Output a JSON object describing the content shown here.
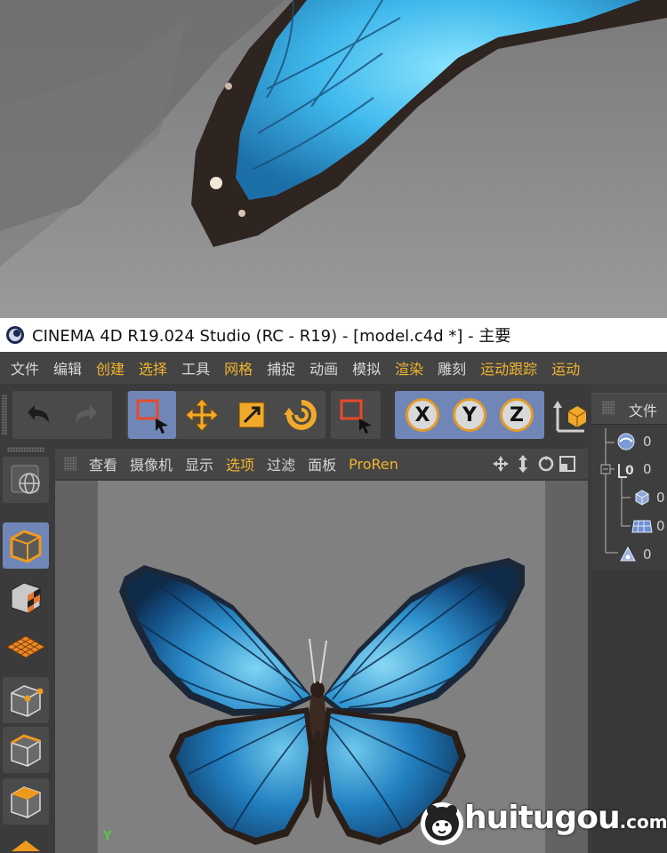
{
  "window": {
    "title": "CINEMA 4D R19.024 Studio (RC - R19) - [model.c4d *] - 主要"
  },
  "menu": {
    "items": [
      {
        "label": "文件",
        "highlight": false
      },
      {
        "label": "编辑",
        "highlight": false
      },
      {
        "label": "创建",
        "highlight": true
      },
      {
        "label": "选择",
        "highlight": true
      },
      {
        "label": "工具",
        "highlight": false
      },
      {
        "label": "网格",
        "highlight": true
      },
      {
        "label": "捕捉",
        "highlight": false
      },
      {
        "label": "动画",
        "highlight": false
      },
      {
        "label": "模拟",
        "highlight": false
      },
      {
        "label": "渲染",
        "highlight": true
      },
      {
        "label": "雕刻",
        "highlight": false
      },
      {
        "label": "运动跟踪",
        "highlight": true
      },
      {
        "label": "运动",
        "highlight": true
      }
    ]
  },
  "toolbar": {
    "axis_x": "X",
    "axis_y": "Y",
    "axis_z": "Z"
  },
  "viewport": {
    "menu": [
      {
        "label": "查看",
        "highlight": false
      },
      {
        "label": "摄像机",
        "highlight": false
      },
      {
        "label": "显示",
        "highlight": false
      },
      {
        "label": "选项",
        "highlight": true
      },
      {
        "label": "过滤",
        "highlight": false
      },
      {
        "label": "面板",
        "highlight": false
      },
      {
        "label": "ProRen",
        "highlight": true
      }
    ],
    "axis_label": "Y"
  },
  "object_panel": {
    "title": "文件",
    "rows": [
      {
        "value": "0"
      },
      {
        "value": "0"
      },
      {
        "value": "0"
      },
      {
        "value": "0"
      },
      {
        "value": "0"
      }
    ]
  },
  "watermark": {
    "text": "huitugou",
    "suffix": ".com"
  },
  "colors": {
    "accent": "#f1b42f",
    "active_button": "#6f86b7",
    "menu_bg": "#444444",
    "viewport_bg": "#808080"
  }
}
